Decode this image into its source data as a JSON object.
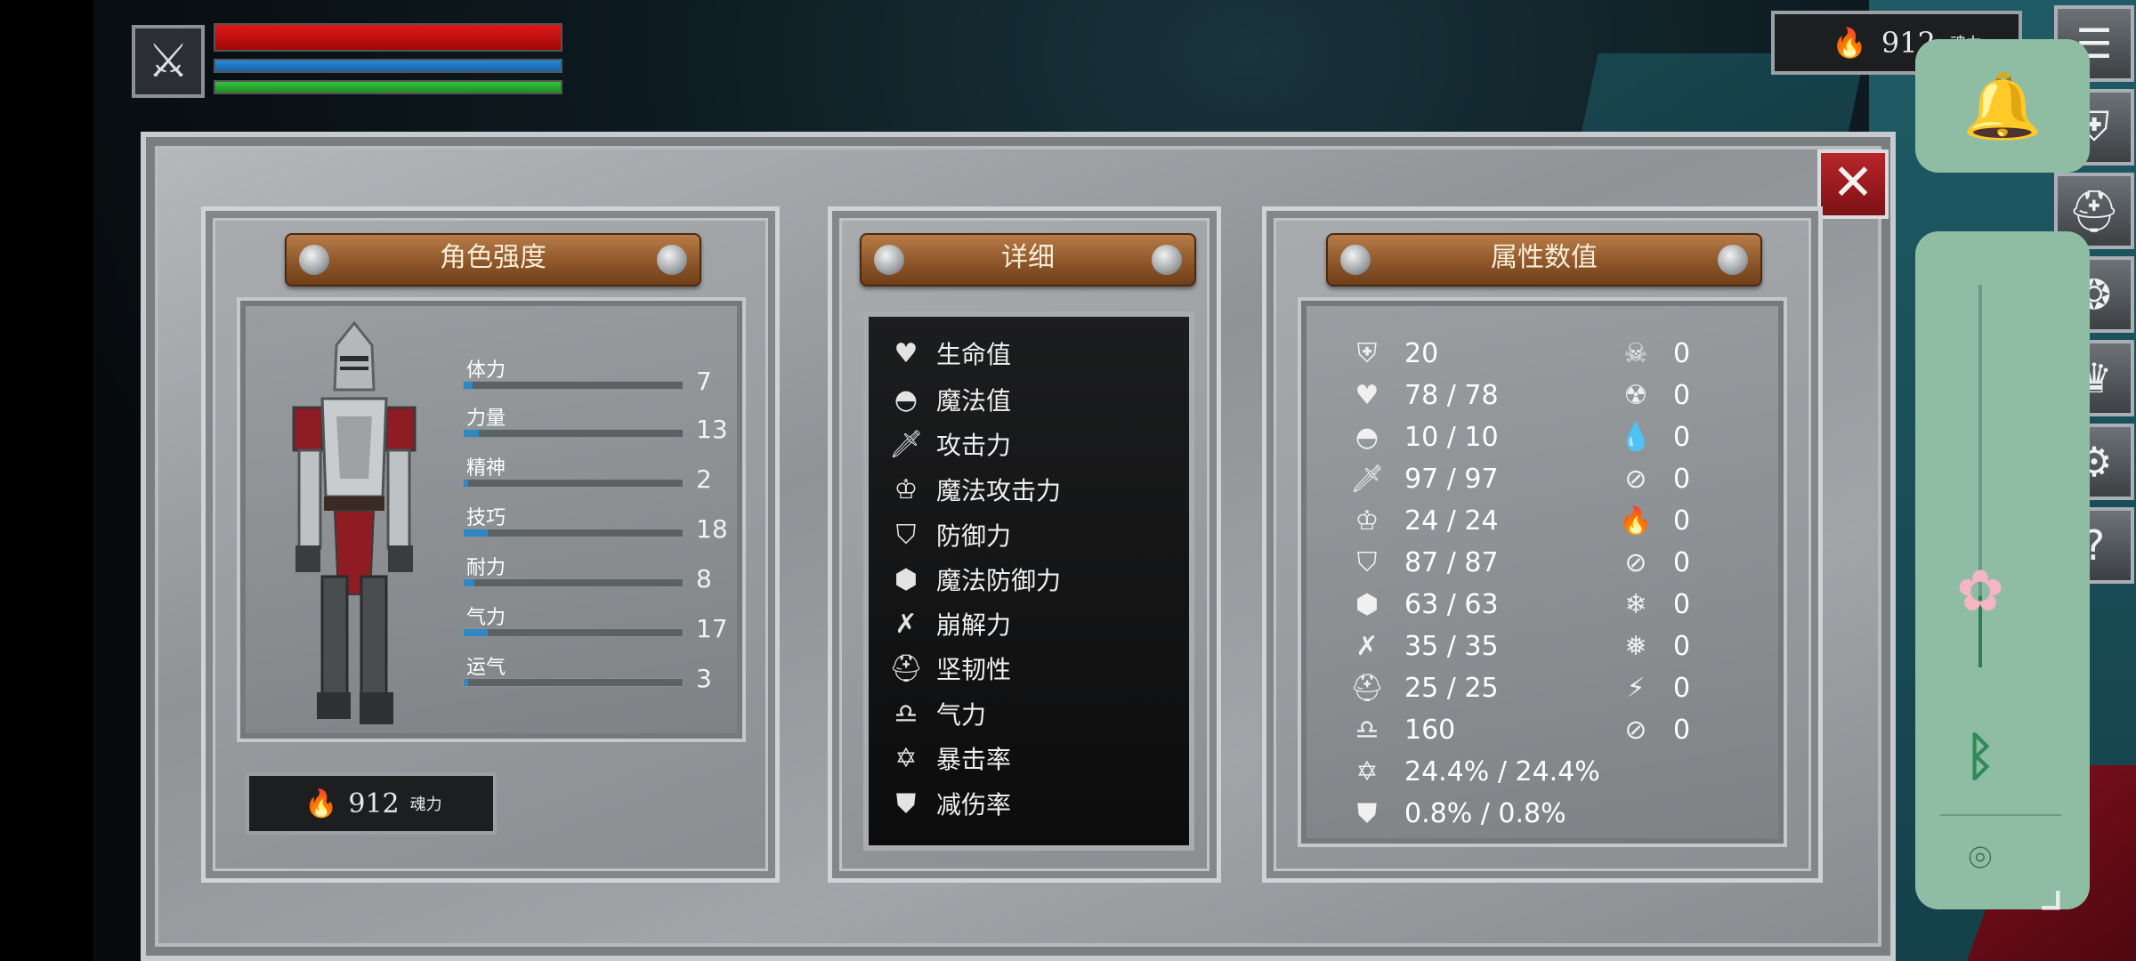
{
  "hud": {
    "soul_top_value": "912",
    "soul_top_unit": "魂力"
  },
  "panel": {
    "left_title": "角色强度",
    "mid_title": "详细",
    "right_title": "属性数值",
    "soul_value": "912",
    "soul_unit": "魂力"
  },
  "stats": [
    {
      "label": "体力",
      "value": "7",
      "fill": 0.04
    },
    {
      "label": "力量",
      "value": "13",
      "fill": 0.07
    },
    {
      "label": "精神",
      "value": "2",
      "fill": 0.02
    },
    {
      "label": "技巧",
      "value": "18",
      "fill": 0.11
    },
    {
      "label": "耐力",
      "value": "8",
      "fill": 0.05
    },
    {
      "label": "气力",
      "value": "17",
      "fill": 0.11
    },
    {
      "label": "运气",
      "value": "3",
      "fill": 0.02
    }
  ],
  "details": [
    {
      "icon": "heart-icon",
      "label": "生命值"
    },
    {
      "icon": "mana-head-icon",
      "label": "魔法值"
    },
    {
      "icon": "sword-icon",
      "label": "攻击力"
    },
    {
      "icon": "magic-crown-icon",
      "label": "魔法攻击力"
    },
    {
      "icon": "shield-icon",
      "label": "防御力"
    },
    {
      "icon": "magic-shield-icon",
      "label": "魔法防御力"
    },
    {
      "icon": "break-icon",
      "label": "崩解力"
    },
    {
      "icon": "helmet-icon",
      "label": "坚韧性"
    },
    {
      "icon": "lungs-icon",
      "label": "气力"
    },
    {
      "icon": "crit-star-icon",
      "label": "暴击率"
    },
    {
      "icon": "reduce-shield-icon",
      "label": "减伤率"
    }
  ],
  "values_left": [
    {
      "icon": "armor-icon",
      "value": "20"
    },
    {
      "icon": "heart-icon",
      "value": "78 / 78"
    },
    {
      "icon": "mana-head-icon",
      "value": "10 / 10"
    },
    {
      "icon": "sword-icon",
      "value": "97 / 97"
    },
    {
      "icon": "magic-crown-icon",
      "value": "24 / 24"
    },
    {
      "icon": "shield-icon",
      "value": "87 / 87"
    },
    {
      "icon": "magic-shield-icon",
      "value": "63 / 63"
    },
    {
      "icon": "break-icon",
      "value": "35 / 35"
    },
    {
      "icon": "helmet-icon",
      "value": "25 / 25"
    },
    {
      "icon": "lungs-icon",
      "value": "160"
    },
    {
      "icon": "crit-star-icon",
      "value": "24.4% / 24.4%"
    },
    {
      "icon": "reduce-shield-icon",
      "value": "0.8% / 0.8%"
    }
  ],
  "values_right": [
    {
      "icon": "skull-icon",
      "value": "0"
    },
    {
      "icon": "poison-skull-icon",
      "value": "0"
    },
    {
      "icon": "drop-icon",
      "value": "0"
    },
    {
      "icon": "no-drop-icon",
      "value": "0"
    },
    {
      "icon": "fire-icon",
      "value": "0"
    },
    {
      "icon": "no-fire-icon",
      "value": "0"
    },
    {
      "icon": "snowflake-icon",
      "value": "0"
    },
    {
      "icon": "no-snowflake-icon",
      "value": "0"
    },
    {
      "icon": "lightning-icon",
      "value": "0"
    },
    {
      "icon": "no-lightning-icon",
      "value": "0"
    }
  ],
  "colors": {
    "hp": "#d01010",
    "mp": "#1f78c8",
    "stamina": "#2fb835",
    "stat_fill": "#2e88c4",
    "close_button": "#a61c20",
    "overlay_panel": "#8fbda4"
  }
}
